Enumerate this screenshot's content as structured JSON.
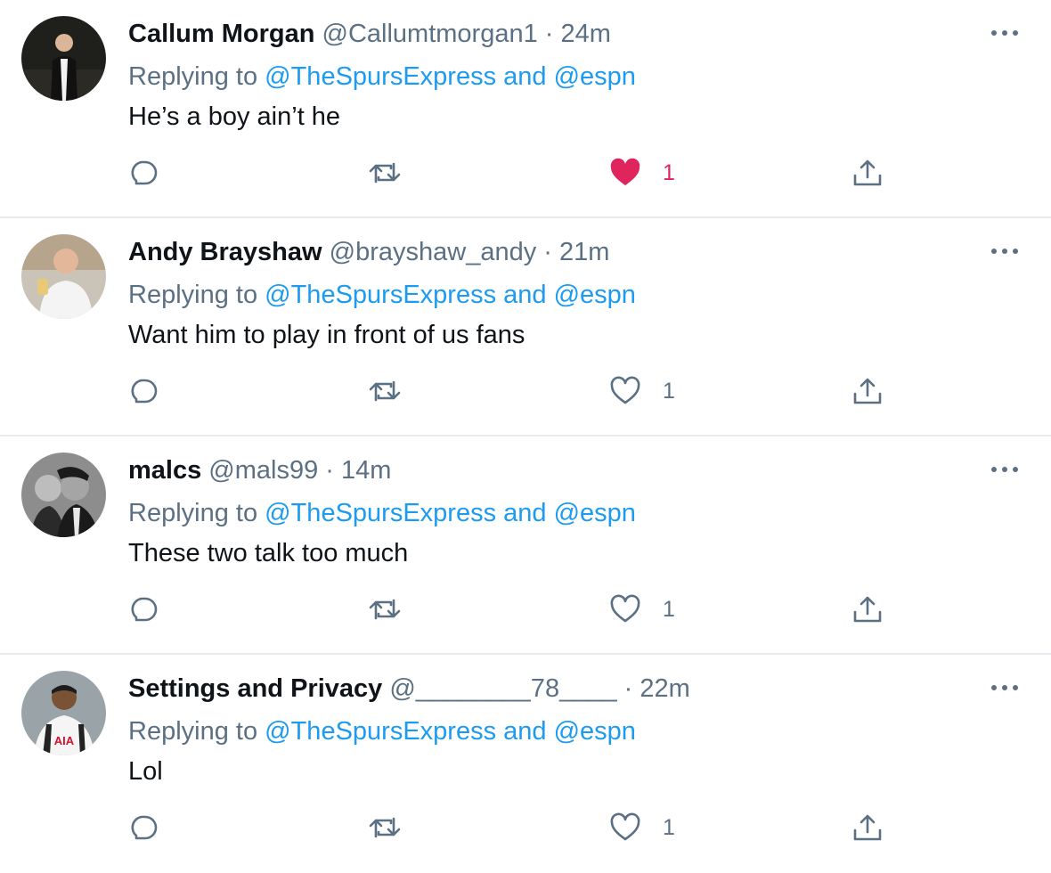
{
  "colors": {
    "text": "#0f1419",
    "secondary": "#5b7083",
    "link": "#1d9bf0",
    "like": "#e0245e",
    "divider": "#e6ecf0"
  },
  "tweets": [
    {
      "name": "Callum Morgan",
      "handle": "@Callumtmorgan1",
      "dot": "·",
      "time": "24m",
      "replying_prefix": "Replying to",
      "replying_to": "@TheSpursExpress and @espn",
      "text": "He’s a boy ain’t he",
      "likes": "1",
      "liked": true,
      "avatar_icon": "profile-photo"
    },
    {
      "name": "Andy Brayshaw",
      "handle": "@brayshaw_andy",
      "dot": "·",
      "time": "21m",
      "replying_prefix": "Replying to",
      "replying_to": "@TheSpursExpress and @espn",
      "text": "Want him to play in front of us fans",
      "likes": "1",
      "liked": false,
      "avatar_icon": "profile-photo"
    },
    {
      "name": "malcs",
      "handle": "@mals99",
      "dot": "·",
      "time": "14m",
      "replying_prefix": "Replying to",
      "replying_to": "@TheSpursExpress and @espn",
      "text": "These two talk too much",
      "likes": "1",
      "liked": false,
      "avatar_icon": "profile-photo"
    },
    {
      "name": "Settings and Privacy",
      "handle": "@________78____",
      "dot": "·",
      "time": "22m",
      "replying_prefix": "Replying to",
      "replying_to": "@TheSpursExpress and @espn",
      "text": "Lol",
      "likes": "1",
      "liked": false,
      "avatar_icon": "profile-photo",
      "avatar_text": "AIA"
    }
  ]
}
